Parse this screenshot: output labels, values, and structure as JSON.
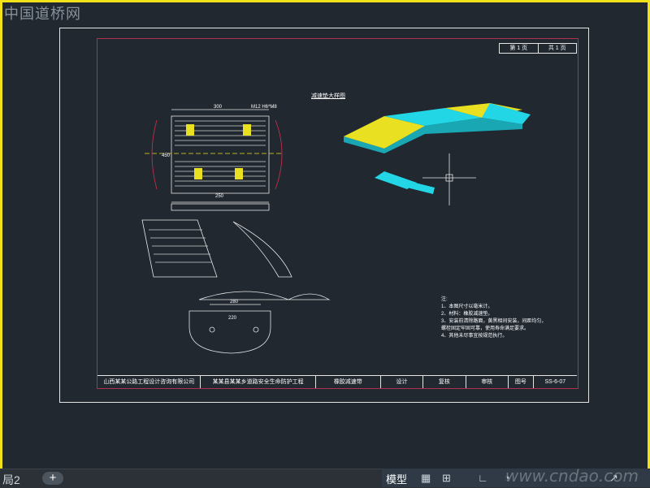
{
  "watermark": {
    "site_cn": "中国道桥网",
    "site_url": "www.cndao.com"
  },
  "drawing": {
    "page_info": [
      "第 1 页",
      "共 1 页"
    ],
    "view_title": "减速垫大样图",
    "dim_labels": {
      "top_width": "300",
      "bolt": "M12 H6*M8",
      "left_h": "450",
      "mid_w": "250",
      "bottom_w": "280",
      "bottom_w2": "220"
    },
    "notes_label": "注:",
    "notes": [
      "1、本图尺寸以毫米计。",
      "2、材料：橡胶减速垫。",
      "3、安装前清除路面，黄黑相间安装，间距均匀，",
      "   螺栓固定牢固可靠，使用寿命满足要求。",
      "4、其他未尽事宜按规范执行。"
    ],
    "title_block": [
      "山西某某公路工程设计咨询有限公司",
      "某某县某某乡道路安全生命防护工程",
      "橡胶减速带",
      "设计",
      "复核",
      "审核",
      "图号",
      "SS-6-07"
    ],
    "colors": {
      "cyan": "#22d6e6",
      "yellow": "#e8e020",
      "red": "#d03050"
    }
  },
  "tabs": {
    "layout2": "局2",
    "add": "+"
  },
  "status": {
    "model": "模型",
    "icons": [
      "grid-icon",
      "snap-icon",
      "ortho-icon",
      "polar-icon",
      "osnap-icon"
    ]
  }
}
